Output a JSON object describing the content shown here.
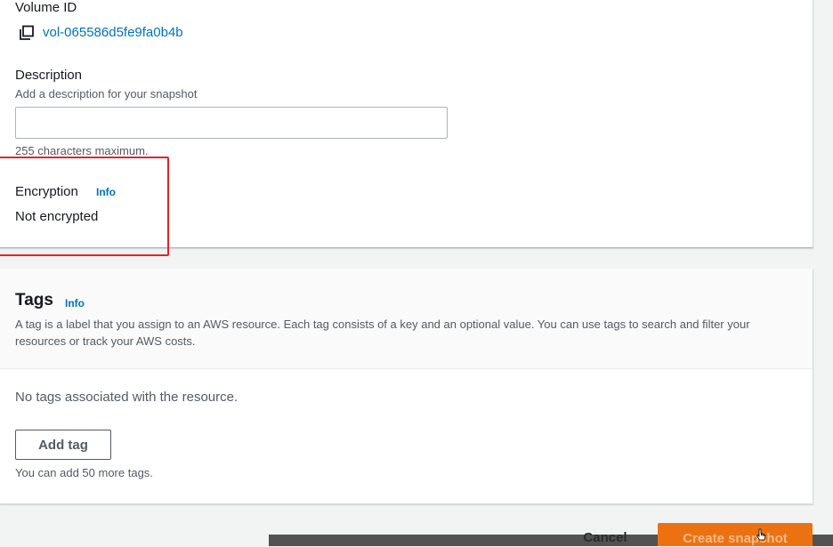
{
  "volume": {
    "label": "Volume ID",
    "id": "vol-065586d5fe9fa0b4b"
  },
  "description": {
    "label": "Description",
    "hint": "Add a description for your snapshot",
    "value": "",
    "constraint": "255 characters maximum."
  },
  "encryption": {
    "label": "Encryption",
    "info": "Info",
    "value": "Not encrypted"
  },
  "tags": {
    "title": "Tags",
    "info": "Info",
    "description": "A tag is a label that you assign to an AWS resource. Each tag consists of a key and an optional value. You can use tags to search and filter your resources or track your AWS costs.",
    "empty_message": "No tags associated with the resource.",
    "add_button": "Add tag",
    "limit_text": "You can add 50 more tags."
  },
  "footer": {
    "cancel_label": "Cancel",
    "create_label": "Create snapshot"
  },
  "colors": {
    "link": "#0073bb",
    "primary_button": "#ec7211",
    "highlight": "#e0252a"
  },
  "icons": {
    "copy": "copy-icon",
    "cursor": "pointer-cursor-icon"
  }
}
